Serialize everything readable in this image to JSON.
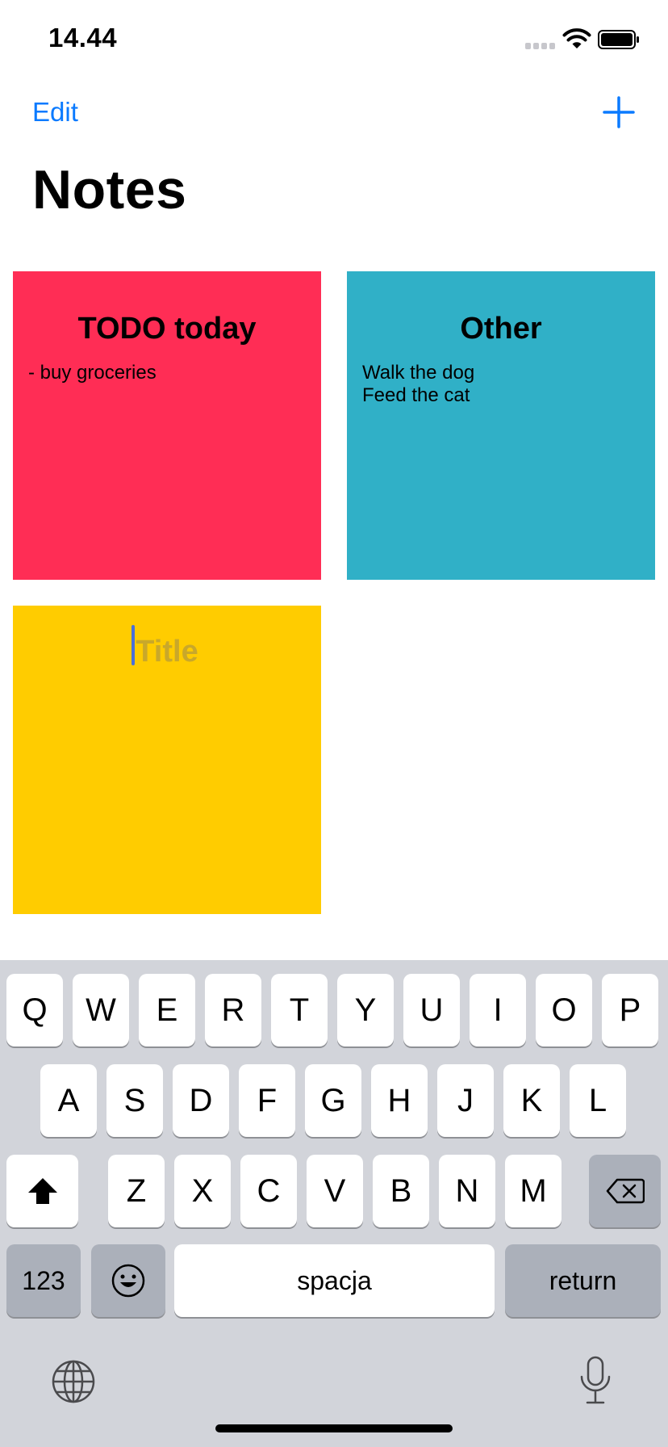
{
  "status_bar": {
    "time": "14.44"
  },
  "nav": {
    "edit_label": "Edit",
    "title": "Notes"
  },
  "notes": [
    {
      "title": "TODO today",
      "body": "- buy groceries",
      "color": "#ff2d55"
    },
    {
      "title": "Other",
      "body": "Walk the dog\nFeed the cat",
      "color": "#30b0c7"
    },
    {
      "title": "",
      "title_placeholder": "Title",
      "body": "",
      "color": "#ffcc00"
    }
  ],
  "keyboard": {
    "row1": [
      "Q",
      "W",
      "E",
      "R",
      "T",
      "Y",
      "U",
      "I",
      "O",
      "P"
    ],
    "row2": [
      "A",
      "S",
      "D",
      "F",
      "G",
      "H",
      "J",
      "K",
      "L"
    ],
    "row3": [
      "Z",
      "X",
      "C",
      "V",
      "B",
      "N",
      "M"
    ],
    "numbers_label": "123",
    "space_label": "spacja",
    "return_label": "return"
  },
  "colors": {
    "accent": "#0a7aff",
    "keyboard_bg": "#d2d4da"
  }
}
